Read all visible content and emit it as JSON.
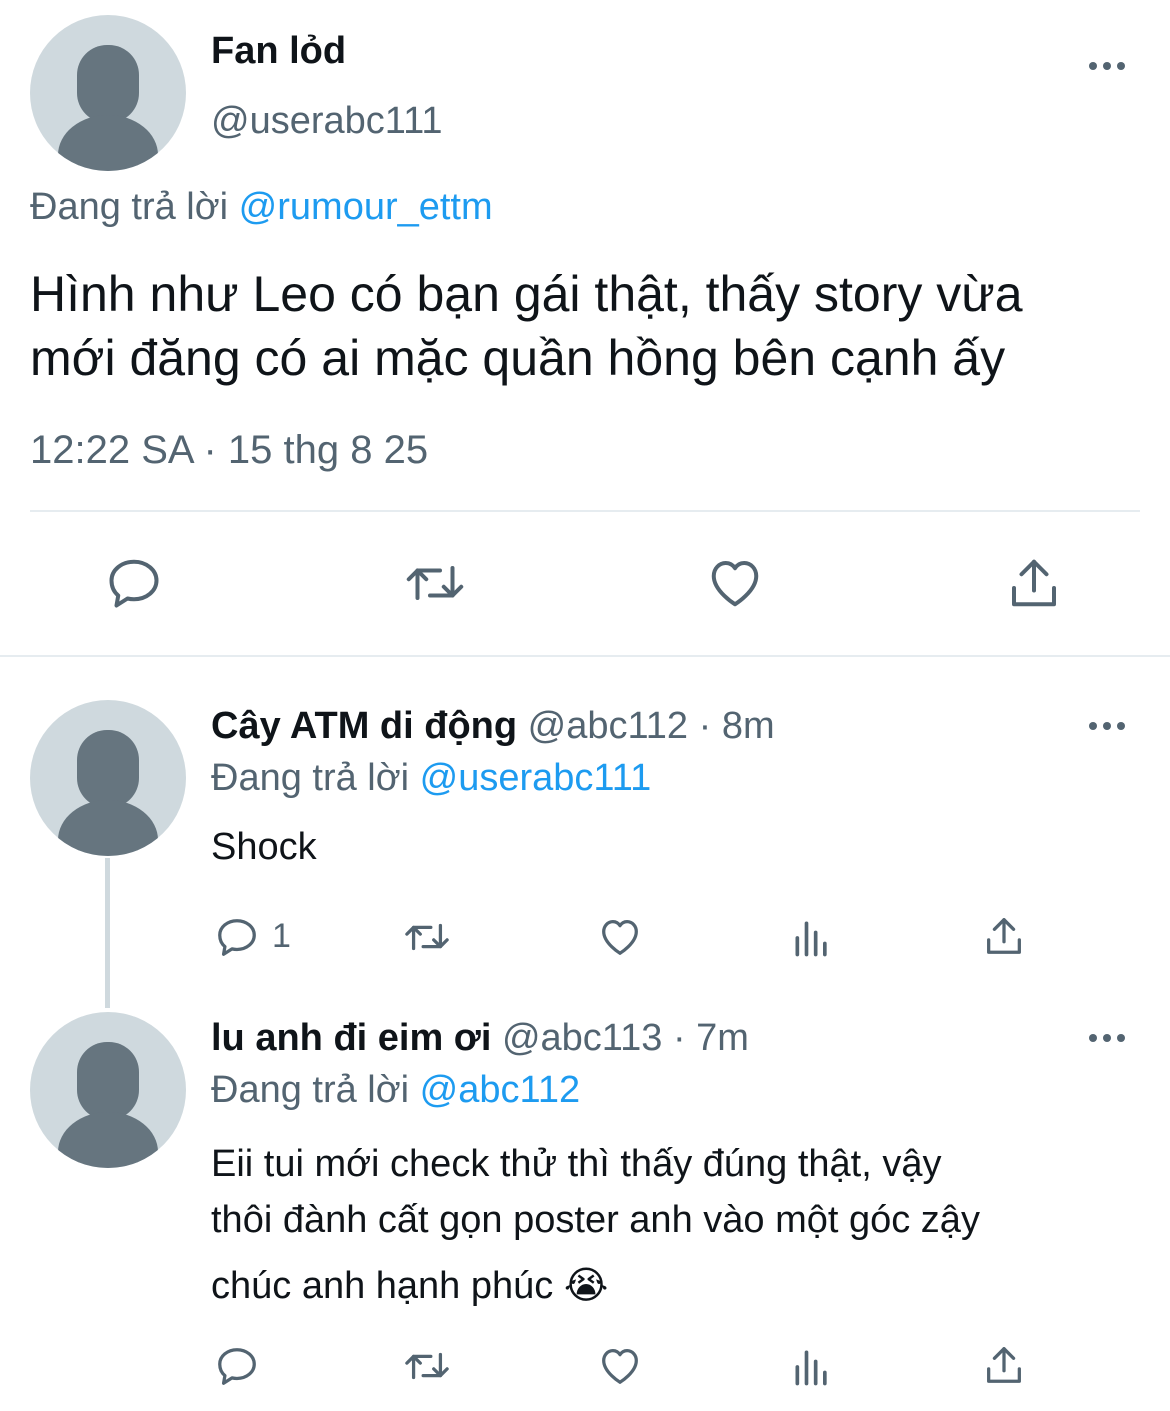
{
  "main_tweet": {
    "name": "Fan lỏd",
    "handle": "@userabc111",
    "replying_prefix": "Đang trả lời",
    "replying_to": "@rumour_ettm",
    "text_line1": "Hình như Leo có bạn gái thật, thấy story vừa",
    "text_line2": "mới đăng có ai mặc quần hồng bên cạnh ấy",
    "timestamp": "12:22 SA · 15 thg 8 25"
  },
  "replies": [
    {
      "name": "Cây ATM di động",
      "handle": "@abc112",
      "time": "· 8m",
      "replying_prefix": "Đang trả lời",
      "replying_to": "@userabc111",
      "text_line1": "Shock",
      "reply_count": "1"
    },
    {
      "name": "lu anh đi eim ơi",
      "handle": "@abc113",
      "time": "· 7m",
      "replying_prefix": "Đang trả lời",
      "replying_to": "@abc112",
      "text_line1": "Eii tui mới check thử thì thấy đúng thật, vậy",
      "text_line2": "thôi đành cất gọn poster anh vào một góc zậy",
      "text_line3": "chúc anh hạnh phúc 😭"
    }
  ],
  "icons": {
    "reply": "reply-icon",
    "retweet": "retweet-icon",
    "like": "heart-icon",
    "share": "share-icon",
    "views": "views-icon",
    "more": "more-icon"
  },
  "colors": {
    "text": "#0f1419",
    "secondary": "#536471",
    "accent": "#1d9bf0",
    "avatar_bg": "#cfd9de",
    "avatar_fg": "#66757f",
    "divider": "#e6ecf0"
  }
}
